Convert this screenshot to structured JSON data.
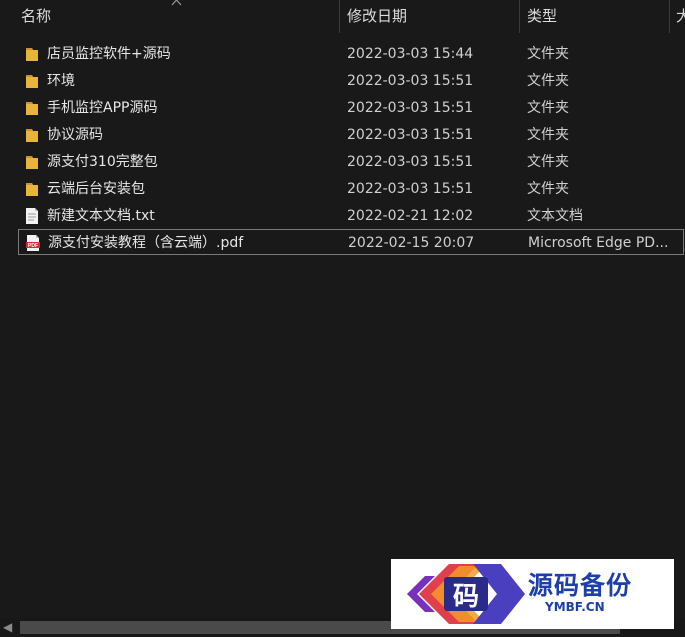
{
  "header": {
    "name": "名称",
    "date": "修改日期",
    "type": "类型",
    "size": "大"
  },
  "files": [
    {
      "name": "店员监控软件+源码",
      "date": "2022-03-03 15:44",
      "type": "文件夹",
      "icon": "folder-icon"
    },
    {
      "name": "环境",
      "date": "2022-03-03 15:51",
      "type": "文件夹",
      "icon": "folder-icon"
    },
    {
      "name": "手机监控APP源码",
      "date": "2022-03-03 15:51",
      "type": "文件夹",
      "icon": "folder-icon"
    },
    {
      "name": "协议源码",
      "date": "2022-03-03 15:51",
      "type": "文件夹",
      "icon": "folder-icon"
    },
    {
      "name": "源支付310完整包",
      "date": "2022-03-03 15:51",
      "type": "文件夹",
      "icon": "folder-icon"
    },
    {
      "name": "云端后台安装包",
      "date": "2022-03-03 15:51",
      "type": "文件夹",
      "icon": "folder-icon"
    },
    {
      "name": "新建文本文档.txt",
      "date": "2022-02-21 12:02",
      "type": "文本文档",
      "icon": "text-file-icon"
    },
    {
      "name": "源支付安装教程（含云端）.pdf",
      "date": "2022-02-15 20:07",
      "type": "Microsoft Edge PD...",
      "icon": "pdf-file-icon",
      "selected": true
    }
  ],
  "watermark": {
    "logo_char": "码",
    "title": "源码备份",
    "url": "YMBF.CN"
  },
  "colors": {
    "background": "#191919",
    "folder": "#e8b43a",
    "watermark_blue": "#1c3faa"
  }
}
